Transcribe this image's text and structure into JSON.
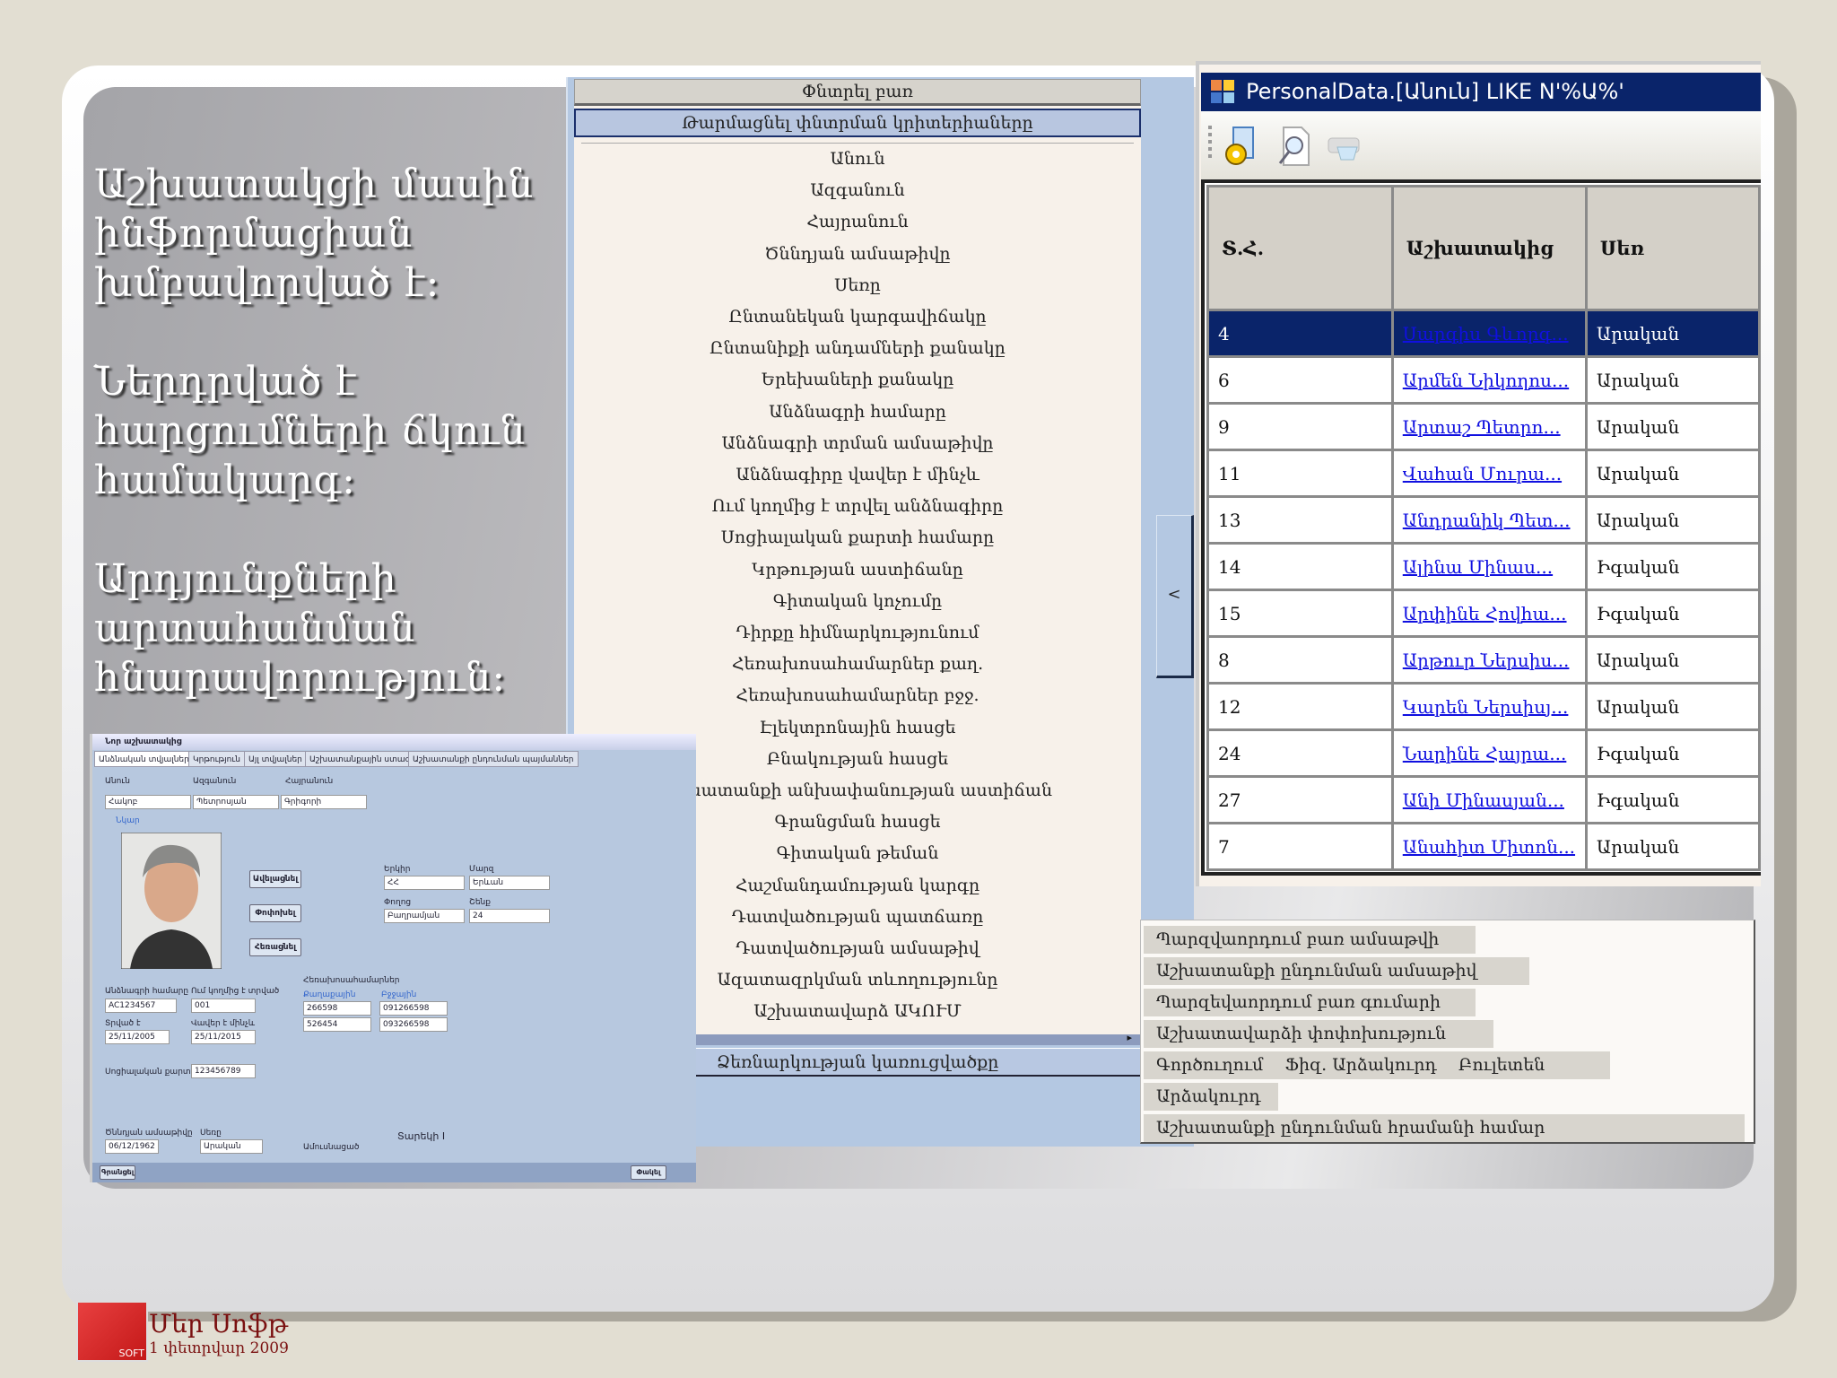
{
  "slide": {
    "intro": [
      "Աշխատակցի մասին ինֆորմացիան խմբավորված է:",
      "Ներդրված է հարցումների ճկուն համակարգ:",
      "Արդյունքների արտահանման հնարավորություն:"
    ],
    "footer": {
      "company": "Մեր Սոֆթ",
      "date": "1 փետրվար 2009",
      "logo_text": "SOFT"
    }
  },
  "search_panel": {
    "search_button": "Փնտրել բառ",
    "refresh_button": "Թարմացնել փնտրման կրիտերիաները",
    "criteria": [
      "Անուն",
      "Ազգանուն",
      "Հայրանուն",
      "Ծննդյան ամսաթիվը",
      "Սեռը",
      "Ընտանեկան կարգավիճակը",
      "Ընտանիքի անդամների քանակը",
      "Երեխաների քանակը",
      "Անձնագրի համարը",
      "Անձնագրի տրման ամսաթիվը",
      "Անձնագիրը վավեր է մինչև",
      "Ում կողմից է տրվել անձնագիրը",
      "Սոցիալական քարտի համարը",
      "Կրթության աստիճանը",
      "Գիտական կոչումը",
      "Դիրքը հիմնարկությունում",
      "Հեռախոսահամարներ քաղ.",
      "Հեռախոսահամարներ բջջ.",
      "Էլեկտրոնային հասցե",
      "Բնակության հասցե",
      "Աշխատանքի անխափանության աստիճան",
      "Գրանցման հասցե",
      "Գիտական թեման",
      "Հաշմանդամության կարգը",
      "Դատվածության պատճառը",
      "Դատվածության ամսաթիվ",
      "Ազատազրկման տևողությունը",
      "Աշխատավարձ ԱԿՈՒՄ"
    ],
    "structure_button": "Ձեռնարկության կառուցվածքը",
    "collapse_button": "<"
  },
  "results_window": {
    "title": "PersonalData.[Անուն] LIKE N'%Ա%'",
    "toolbar": [
      "settings-icon",
      "preview-icon",
      "print-icon"
    ],
    "columns": [
      "Տ.Հ.",
      "Աշխատակից",
      "Սեռ"
    ],
    "selected_row": 0,
    "rows": [
      [
        "4",
        "Սարգիս Գևորգ...",
        "Արական"
      ],
      [
        "6",
        "Արմեն Նիկողոս...",
        "Արական"
      ],
      [
        "9",
        "Արտաշ Պետրո...",
        "Արական"
      ],
      [
        "11",
        "Վահան Մուրա...",
        "Արական"
      ],
      [
        "13",
        "Անդրանիկ Պետ...",
        "Արական"
      ],
      [
        "14",
        "Ալինա Մինաս...",
        "Իգական"
      ],
      [
        "15",
        "Արփինե Հովհա...",
        "Իգական"
      ],
      [
        "8",
        "Արթուր Ներսիս...",
        "Արական"
      ],
      [
        "12",
        "Կարեն Ներսիսյ...",
        "Արական"
      ],
      [
        "24",
        "Նարինե Հայրա...",
        "Իգական"
      ],
      [
        "27",
        "Անի Մինասյան...",
        "Իգական"
      ],
      [
        "7",
        "Անահիտ Միտոն...",
        "Արական"
      ]
    ]
  },
  "context_menu": [
    "Պարզվաորդում բառ ամսաթվի",
    "Աշխատանքի ընդունման ամսաթիվ",
    "Պարզեվաորդում բառ գումարի",
    "Աշխատավարձի փոփոխություն",
    "Գործուղում    Ֆիզ. Արձակուրդ    Բուլետեն",
    "Արձակուրդ",
    "Աշխատանքի ընդունման հրամանի համար"
  ],
  "embedded_form": {
    "title": "Նոր աշխատակից",
    "tabs": [
      "Անձնական տվյալներ",
      "Կրթություն",
      "Այլ տվյալներ",
      "Աշխատանքային ստաժ",
      "Աշխատանքի ընդունման պայմաններ"
    ],
    "labels": {
      "first_name": "Անուն",
      "last_name": "Ազգանուն",
      "patronymic": "Հայրանուն",
      "photo": "Նկար",
      "passport": "Անձնագրի համարը",
      "issued_by": "Ում կողմից է տրված",
      "issued": "Տրված է",
      "valid": "Վավեր է մինչև",
      "social": "Սոցիալական քարտի համարը",
      "birth": "Ծննդյան ամսաթիվը",
      "sex": "Սեռը",
      "phones": "Հեռախոսահամարներ",
      "home": "Քաղաքային",
      "mobile": "Բջջային",
      "married": "Ամուսնացած",
      "country": "Երկիր",
      "city": "Մարզ",
      "street": "Փողոց",
      "house": "Շենք"
    },
    "values": {
      "first_name": "Հակոբ",
      "last_name": "Պետրոսյան",
      "patronymic": "Գրիգորի",
      "passport": "AC1234567",
      "issued_by": "001",
      "issued": "25/11/2005",
      "valid": "25/11/2015",
      "social": "123456789",
      "birth": "06/12/1962",
      "sex": "Արական",
      "home1": "266598",
      "home2": "526454",
      "mob1": "091266598",
      "mob2": "093266598",
      "country": "ՀՀ",
      "city": "Երևան",
      "street": "Բաղրամյան",
      "house": "24"
    },
    "buttons": {
      "add": "Ավելացնել",
      "change": "Փոփոխել",
      "delete": "Հեռացնել",
      "print": "Գրանցել",
      "close": "Փակել"
    },
    "extra": "Տարեկի I"
  },
  "colors": {
    "title_bar": "#0a246a",
    "selected_row": "#0a246a",
    "link": "#1010e0",
    "panel_blue": "#b4c8e2",
    "list_bg": "#f7f1ea",
    "logo_red": "#d02020"
  }
}
